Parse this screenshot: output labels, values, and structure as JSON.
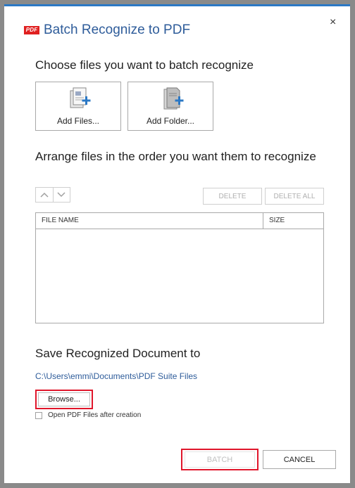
{
  "dialog": {
    "logo_text": "PDF",
    "title": "Batch Recognize to PDF",
    "close_glyph": "×"
  },
  "choose_section": {
    "heading": "Choose files you want to batch recognize",
    "add_files_label": "Add Files...",
    "add_folder_label": "Add Folder..."
  },
  "arrange_section": {
    "heading": "Arrange files in the order you want them to recognize",
    "delete_label": "DELETE",
    "delete_all_label": "DELETE ALL",
    "columns": [
      "FILE NAME",
      "SIZE"
    ],
    "rows": []
  },
  "save_section": {
    "heading": "Save Recognized Document to",
    "path": "C:\\Users\\emmi\\Documents\\PDF Suite Files",
    "browse_label": "Browse...",
    "open_after_label": "Open PDF Files after creation",
    "open_after_checked": false
  },
  "footer": {
    "batch_label": "BATCH",
    "cancel_label": "CANCEL"
  },
  "colors": {
    "accent": "#2b78c5",
    "title": "#2e5c9a",
    "highlight": "#e0162b",
    "logo": "#e02020"
  }
}
